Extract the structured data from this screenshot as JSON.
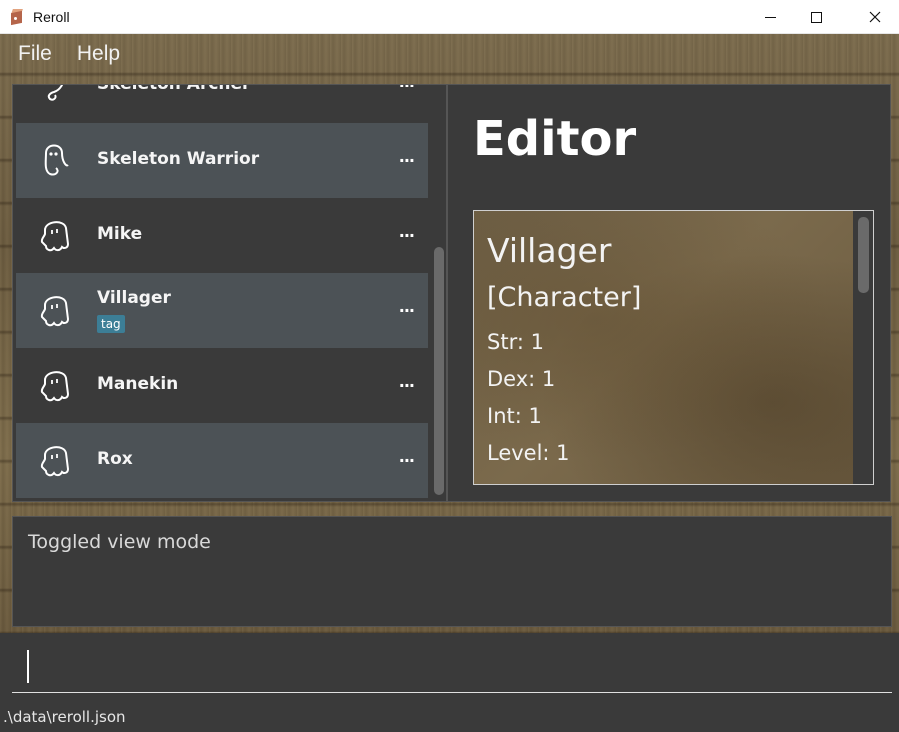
{
  "window": {
    "title": "Reroll",
    "app_icon": "dice-box-icon"
  },
  "menu": {
    "items": [
      "File",
      "Help"
    ]
  },
  "list": {
    "items": [
      {
        "name": "Skeleton Archer",
        "icon": "ghost-tail-icon",
        "tag": "",
        "more": "..."
      },
      {
        "name": "Skeleton Warrior",
        "icon": "ghost-tail-icon",
        "tag": "",
        "more": "..."
      },
      {
        "name": "Mike",
        "icon": "ghost-icon",
        "tag": "",
        "more": "..."
      },
      {
        "name": "Villager",
        "icon": "ghost-icon",
        "tag": "tag",
        "more": "..."
      },
      {
        "name": "Manekin",
        "icon": "ghost-icon",
        "tag": "",
        "more": "..."
      },
      {
        "name": "Rox",
        "icon": "ghost-icon",
        "tag": "",
        "more": "..."
      }
    ]
  },
  "editor": {
    "title": "Editor",
    "entity_name": "Villager",
    "entity_type": "[Character]",
    "stats": [
      "Str: 1",
      "Dex: 1",
      "Int: 1",
      "Level: 1"
    ]
  },
  "result": {
    "text": "Toggled view mode"
  },
  "command": {
    "value": ""
  },
  "status": {
    "path": ".\\data\\reroll.json"
  },
  "colors": {
    "panel_bg": "#3a3a3a",
    "row_alt_bg": "#4c5256",
    "tag_bg": "#3c7e96",
    "text": "#f5f5f5"
  }
}
